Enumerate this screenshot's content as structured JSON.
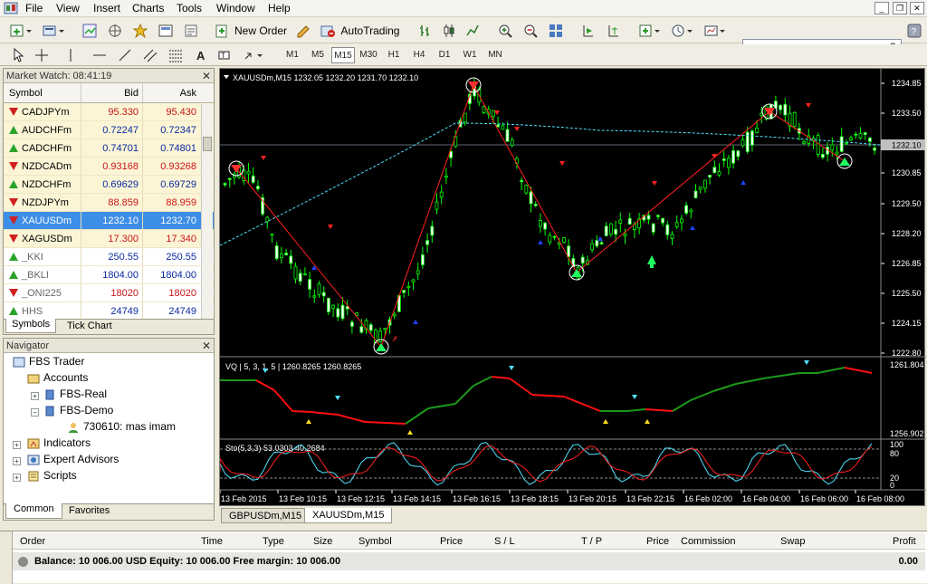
{
  "menu": [
    "File",
    "View",
    "Insert",
    "Charts",
    "Tools",
    "Window",
    "Help"
  ],
  "toolbar": {
    "new_order": "New Order",
    "autotrading": "AutoTrading"
  },
  "timeframes": [
    "M1",
    "M5",
    "M15",
    "M30",
    "H1",
    "H4",
    "D1",
    "W1",
    "MN"
  ],
  "active_timeframe": "M15",
  "market_watch": {
    "title": "Market Watch: 08:41:19",
    "columns": [
      "Symbol",
      "Bid",
      "Ask"
    ],
    "rows": [
      {
        "symbol": "CADJPYm",
        "bid": "95.330",
        "ask": "95.430",
        "dir": "dn"
      },
      {
        "symbol": "AUDCHFm",
        "bid": "0.72247",
        "ask": "0.72347",
        "dir": "up"
      },
      {
        "symbol": "CADCHFm",
        "bid": "0.74701",
        "ask": "0.74801",
        "dir": "up"
      },
      {
        "symbol": "NZDCADm",
        "bid": "0.93168",
        "ask": "0.93268",
        "dir": "dn"
      },
      {
        "symbol": "NZDCHFm",
        "bid": "0.69629",
        "ask": "0.69729",
        "dir": "up"
      },
      {
        "symbol": "NZDJPYm",
        "bid": "88.859",
        "ask": "88.959",
        "dir": "dn"
      },
      {
        "symbol": "XAUUSDm",
        "bid": "1232.10",
        "ask": "1232.70",
        "dir": "dn"
      },
      {
        "symbol": "XAGUSDm",
        "bid": "17.300",
        "ask": "17.340",
        "dir": "dn"
      },
      {
        "symbol": "_KKI",
        "bid": "250.55",
        "ask": "250.55",
        "dir": "up"
      },
      {
        "symbol": "_BKLI",
        "bid": "1804.00",
        "ask": "1804.00",
        "dir": "up"
      },
      {
        "symbol": "_ONI225",
        "bid": "18020",
        "ask": "18020",
        "dir": "dn"
      },
      {
        "symbol": "HHS",
        "bid": "24749",
        "ask": "24749",
        "dir": "up"
      }
    ],
    "tabs": [
      "Symbols",
      "Tick Chart"
    ]
  },
  "navigator": {
    "title": "Navigator",
    "root": "FBS Trader",
    "accounts": "Accounts",
    "real": "FBS-Real",
    "demo": "FBS-Demo",
    "account": "730610: mas imam",
    "indicators": "Indicators",
    "experts": "Expert Advisors",
    "scripts": "Scripts",
    "tabs": [
      "Common",
      "Favorites"
    ]
  },
  "chart": {
    "title": "XAUUSDm,M15  1232.05 1232.20 1231.70 1232.10",
    "price_labels": [
      "1234.85",
      "1233.50",
      "1232.10",
      "1230.85",
      "1229.50",
      "1228.20",
      "1226.85",
      "1225.50",
      "1224.15",
      "1222.80"
    ],
    "current_price": "1232.10",
    "vq_label": "VQ | 5, 3, 1, 5 |  1260.8265 1260.8265",
    "vq_scale": [
      "1261.804",
      "1256.902"
    ],
    "sto_label": "Sto(5,3,3) 53.0303 40.2684",
    "sto_scale": [
      "100",
      "80",
      "20",
      "0"
    ],
    "time_labels": [
      "13 Feb 2015",
      "13 Feb 10:15",
      "13 Feb 12:15",
      "13 Feb 14:15",
      "13 Feb 16:15",
      "13 Feb 18:15",
      "13 Feb 20:15",
      "13 Feb 22:15",
      "16 Feb 02:00",
      "16 Feb 04:00",
      "16 Feb 06:00",
      "16 Feb 08:00"
    ]
  },
  "chart_tabs": [
    "GBPUSDm,M15",
    "XAUUSDm,M15"
  ],
  "terminal": {
    "columns": [
      "Order",
      "Time",
      "Type",
      "Size",
      "Symbol",
      "Price",
      "S / L",
      "T / P",
      "Price",
      "Commission",
      "Swap",
      "Profit"
    ],
    "balance": "Balance: 10 006.00 USD  Equity: 10 006.00  Free margin: 10 006.00",
    "profit": "0.00"
  }
}
